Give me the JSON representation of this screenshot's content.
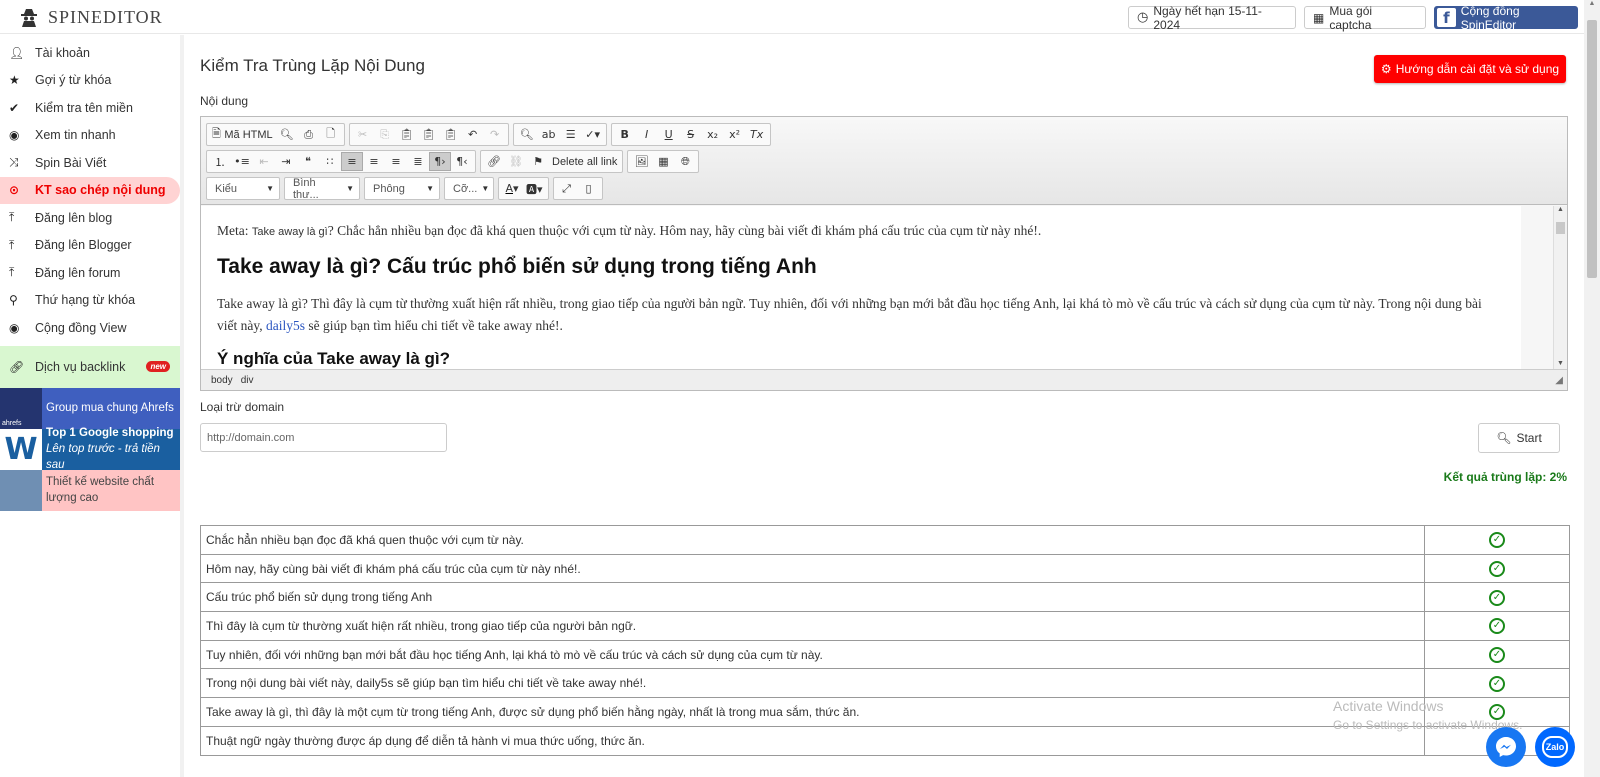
{
  "brand": {
    "name": "SPINEDITOR"
  },
  "header": {
    "expiry": "Ngày hết hạn 15-11-2024",
    "captcha": "Mua gói captcha",
    "community": "Cộng đồng SpinEditor"
  },
  "sidebar": {
    "items": [
      {
        "label": "Tài khoản",
        "icon": "user-icon"
      },
      {
        "label": "Gợi ý từ khóa",
        "icon": "star-icon"
      },
      {
        "label": "Kiểm tra tên miền",
        "icon": "check-icon"
      },
      {
        "label": "Xem tin nhanh",
        "icon": "eye-icon"
      },
      {
        "label": "Spin Bài Viết",
        "icon": "shuffle-icon"
      },
      {
        "label": "KT sao chép nội dung",
        "icon": "copy-check-icon"
      },
      {
        "label": "Đăng lên blog",
        "icon": "upload-icon"
      },
      {
        "label": "Đăng lên Blogger",
        "icon": "upload-icon"
      },
      {
        "label": "Đăng lên forum",
        "icon": "upload-icon"
      },
      {
        "label": "Thứ hạng từ khóa",
        "icon": "search-icon"
      },
      {
        "label": "Cộng đồng View",
        "icon": "eye-icon"
      }
    ],
    "backlink": {
      "label": "Dịch vụ backlink",
      "badge": "new"
    },
    "promos": {
      "ahrefs": {
        "label": "Group mua chung Ahrefs",
        "logo": "ahrefs"
      },
      "gshop": {
        "title": "Top 1 Google shopping",
        "subtitle": "Lên top trước - trả tiền sau"
      },
      "web": {
        "label": "Thiết kế website chất lượng cao"
      }
    }
  },
  "main": {
    "title": "Kiểm Tra Trùng Lặp Nội Dung",
    "guide_button": "Hướng dẫn cài đặt và sử dụng",
    "content_label": "Nội dung",
    "exclude_label": "Loại trừ domain",
    "domain_placeholder": "http://domain.com",
    "start_button": "Start",
    "result": "Kết quả trùng lặp: 2%"
  },
  "editor": {
    "html_button": "Mã HTML",
    "delete_links": "Delete all link",
    "combo_style": "Kiểu",
    "combo_format": "Bình thư...",
    "combo_font": "Phông",
    "combo_size": "Cỡ...",
    "path": [
      "body",
      "div"
    ],
    "meta_prefix": "Meta: ",
    "meta_small": "Take away là gì",
    "meta_rest": "? Chắc hẳn nhiều bạn đọc đã khá quen thuộc với cụm từ này. Hôm nay, hãy cùng bài viết đi khám phá cấu trúc của cụm từ này nhé!.",
    "h1": "Take away là gì? Cấu trúc phổ biến sử dụng trong tiếng Anh",
    "para_a": "Take away là gì? Thì đây là cụm từ thường xuất hiện rất nhiều, trong giao tiếp của người bản ngữ. Tuy nhiên, đối với những bạn mới bắt đầu học tiếng Anh, lại khá tò mò về cấu trúc và cách sử dụng của cụm từ này. Trong nội dung bài viết này, ",
    "para_link": "daily5s",
    "para_b": " sẽ giúp bạn tìm hiểu chi tiết về take away nhé!.",
    "h2": "Ý nghĩa của Take away là gì?"
  },
  "results": [
    "Chắc hẳn nhiều bạn đọc đã khá quen thuộc với cụm từ này.",
    "Hôm nay, hãy cùng bài viết đi khám phá cấu trúc của cụm từ này nhé!.",
    "Cấu trúc phổ biến sử dụng trong tiếng Anh",
    "Thì đây là cụm từ thường xuất hiện rất nhiều, trong giao tiếp của người bản ngữ.",
    "Tuy nhiên, đối với những bạn mới bắt đầu học tiếng Anh, lại khá tò mò về cấu trúc và cách sử dụng của cụm từ này.",
    "Trong nội dung bài viết này, daily5s sẽ giúp bạn tìm hiểu chi tiết về take away nhé!.",
    "Take away là gì, thì đây là một cụm từ trong tiếng Anh, được sử dụng phổ biến hằng ngày, nhất là trong mua sắm, thức ăn.",
    "Thuật ngữ ngày thường được áp dụng để diễn tả hành vi mua thức uống, thức ăn."
  ],
  "watermark": {
    "title": "Activate Windows",
    "subtitle": "Go to Settings to activate Windows."
  },
  "chat": {
    "zalo": "Zalo"
  },
  "colors": {
    "accent_red": "#ff0000",
    "result_green": "#1a7a1a",
    "facebook": "#3b5998",
    "active_bg": "#ffd3d3"
  }
}
